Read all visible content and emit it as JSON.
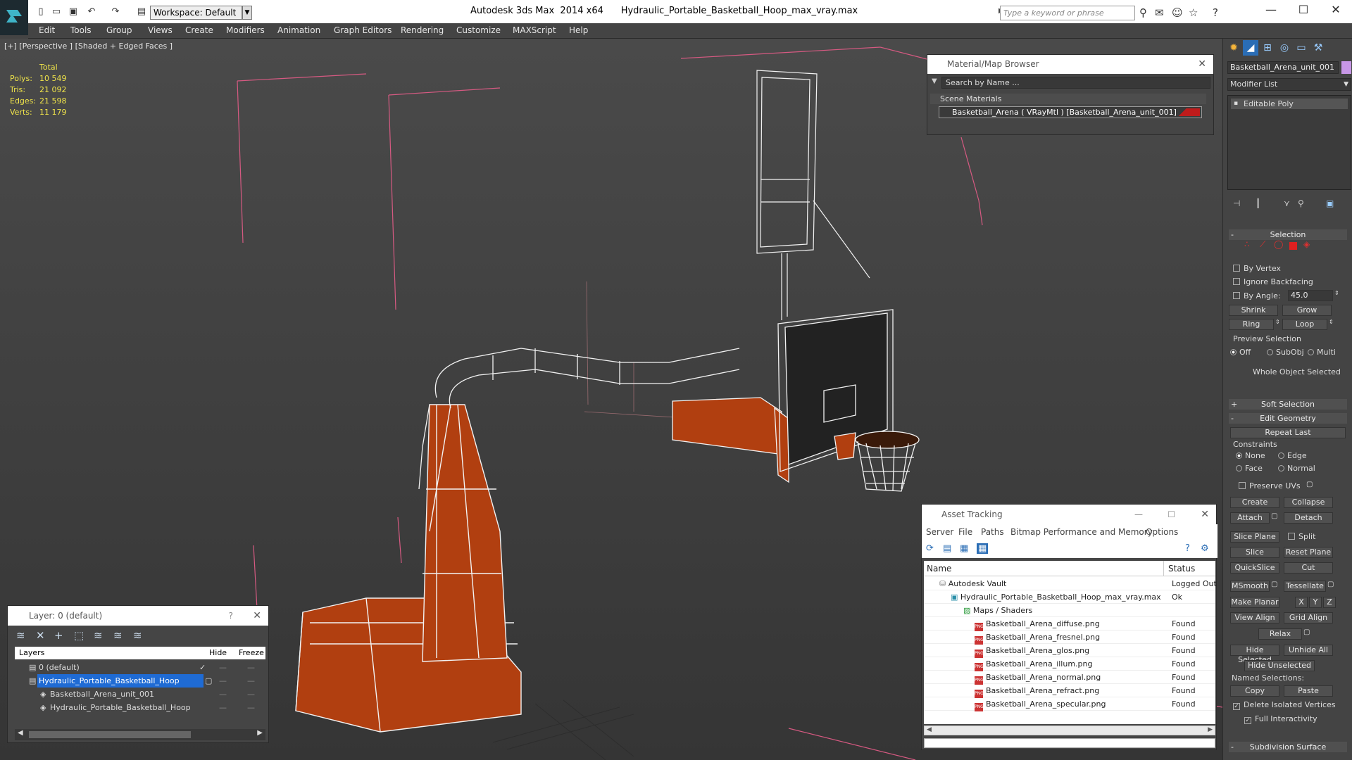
{
  "titlebar": {
    "app": "Autodesk 3ds Max  2014 x64",
    "file": "Hydraulic_Portable_Basketball_Hoop_max_vray.max",
    "workspace": "Workspace: Default",
    "search_placeholder": "Type a keyword or phrase"
  },
  "menu": [
    "Edit",
    "Tools",
    "Group",
    "Views",
    "Create",
    "Modifiers",
    "Animation",
    "Graph Editors",
    "Rendering",
    "Customize",
    "MAXScript",
    "Help"
  ],
  "viewport": {
    "label": "[+] [Perspective ] [Shaded + Edged Faces ]",
    "stats": {
      "total": "Total",
      "polys_label": "Polys:",
      "polys": "10 549",
      "tris_label": "Tris:",
      "tris": "21 092",
      "edges_label": "Edges:",
      "edges": "21 598",
      "verts_label": "Verts:",
      "verts": "11 179"
    }
  },
  "material_browser": {
    "title": "Material/Map Browser",
    "search": "Search by Name ...",
    "section": "Scene Materials",
    "item": "Basketball_Arena  ( VRayMtl )  [Basketball_Arena_unit_001]"
  },
  "layer_panel": {
    "title": "Layer: 0 (default)",
    "help": "?",
    "columns": {
      "layers": "Layers",
      "hide": "Hide",
      "freeze": "Freeze"
    },
    "rows": [
      "0 (default)",
      "Hydraulic_Portable_Basketball_Hoop",
      "Basketball_Arena_unit_001",
      "Hydraulic_Portable_Basketball_Hoop"
    ]
  },
  "asset_tracking": {
    "title": "Asset Tracking",
    "menu": [
      "Server",
      "File",
      "Paths",
      "Bitmap Performance and Memory",
      "Options"
    ],
    "columns": {
      "name": "Name",
      "status": "Status"
    },
    "rows": [
      {
        "name": "Autodesk Vault",
        "status": "Logged Out"
      },
      {
        "name": "Hydraulic_Portable_Basketball_Hoop_max_vray.max",
        "status": "Ok"
      },
      {
        "name": "Maps / Shaders",
        "status": ""
      },
      {
        "name": "Basketball_Arena_diffuse.png",
        "status": "Found"
      },
      {
        "name": "Basketball_Arena_fresnel.png",
        "status": "Found"
      },
      {
        "name": "Basketball_Arena_glos.png",
        "status": "Found"
      },
      {
        "name": "Basketball_Arena_illum.png",
        "status": "Found"
      },
      {
        "name": "Basketball_Arena_normal.png",
        "status": "Found"
      },
      {
        "name": "Basketball_Arena_refract.png",
        "status": "Found"
      },
      {
        "name": "Basketball_Arena_specular.png",
        "status": "Found"
      }
    ]
  },
  "command_panel": {
    "object_name": "Basketball_Arena_unit_001",
    "modifier_list": "Modifier List",
    "stack_item": "Editable Poly",
    "selection": {
      "header": "Selection",
      "by_vertex": "By Vertex",
      "ignore_backfacing": "Ignore Backfacing",
      "by_angle": "By Angle:",
      "angle_value": "45.0",
      "shrink": "Shrink",
      "grow": "Grow",
      "ring": "Ring",
      "loop": "Loop",
      "preview": "Preview Selection",
      "off": "Off",
      "subobj": "SubObj",
      "multi": "Multi",
      "status": "Whole Object Selected"
    },
    "soft_selection": "Soft Selection",
    "edit_geometry": {
      "header": "Edit Geometry",
      "repeat_last": "Repeat Last",
      "constraints": "Constraints",
      "none": "None",
      "edge": "Edge",
      "face": "Face",
      "normal": "Normal",
      "preserve_uvs": "Preserve UVs",
      "create": "Create",
      "collapse": "Collapse",
      "attach": "Attach",
      "detach": "Detach",
      "slice_plane": "Slice Plane",
      "split": "Split",
      "slice": "Slice",
      "reset_plane": "Reset Plane",
      "quickslice": "QuickSlice",
      "cut": "Cut",
      "msmooth": "MSmooth",
      "tessellate": "Tessellate",
      "make_planar": "Make Planar",
      "x": "X",
      "y": "Y",
      "z": "Z",
      "view_align": "View Align",
      "grid_align": "Grid Align",
      "relax": "Relax",
      "hide_selected": "Hide Selected",
      "unhide_all": "Unhide All",
      "hide_unselected": "Hide Unselected",
      "named_selections": "Named Selections:",
      "copy": "Copy",
      "paste": "Paste",
      "delete_isolated": "Delete Isolated Vertices",
      "full_interactivity": "Full Interactivity"
    },
    "subdivision_surface": "Subdivision Surface"
  }
}
